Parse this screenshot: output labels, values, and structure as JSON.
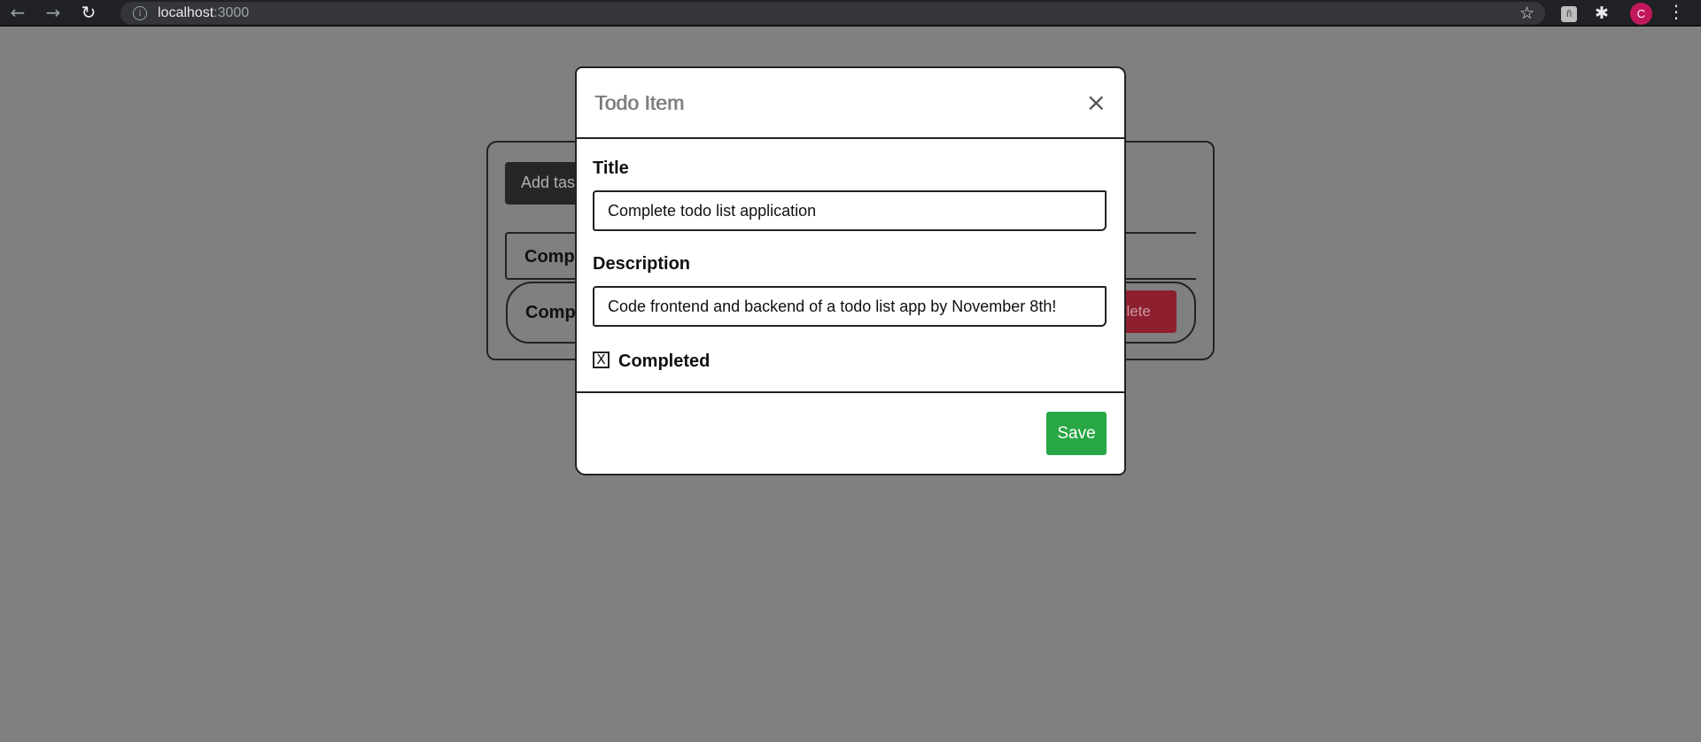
{
  "browser": {
    "back_icon": "←",
    "forward_icon": "→",
    "reload_icon": "↻",
    "info_icon": "i",
    "url_host": "localhost",
    "url_port": ":3000",
    "star_icon": "☆",
    "ext_icon_1": "ñ",
    "ext_icon_2": "✱",
    "avatar_letter": "C",
    "menu_icon": "⋮"
  },
  "background_page": {
    "add_button_label": "Add task",
    "item_1_label": "Comp",
    "item_2_label": "Comp",
    "delete_button_label": "elete"
  },
  "modal": {
    "title": "Todo Item",
    "close_icon": "×",
    "title_label": "Title",
    "title_value": "Complete todo list application",
    "description_label": "Description",
    "description_value": "Code frontend and backend of a todo list app by November 8th!",
    "checkbox_mark": "X",
    "completed_label": "Completed",
    "save_label": "Save"
  },
  "colors": {
    "overlay": "#808080",
    "save": "#28a745",
    "delete": "#8e1f2e",
    "avatar": "#c2185b"
  }
}
